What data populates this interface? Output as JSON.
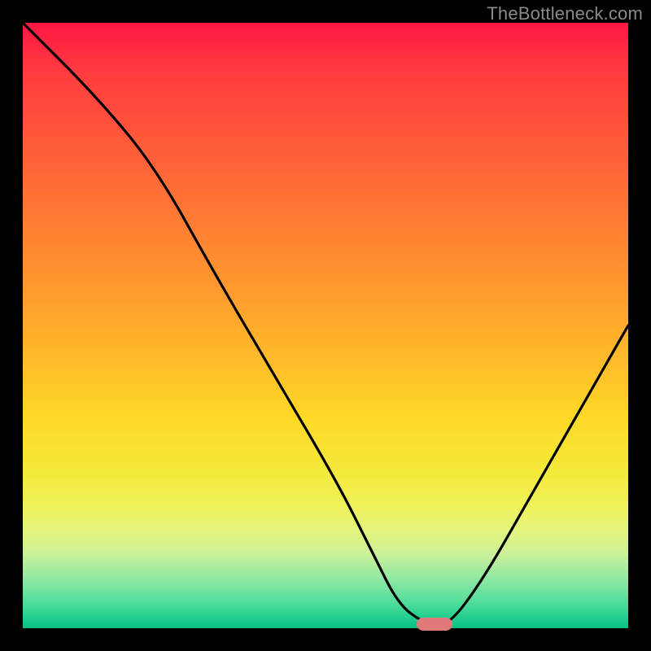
{
  "watermark": "TheBottleneck.com",
  "colors": {
    "frame": "#000000",
    "curve_stroke": "#000000",
    "marker_fill": "#e07a7a",
    "gradient_top": "#ff1744",
    "gradient_mid": "#ffd826",
    "gradient_bottom": "#0fbf80"
  },
  "chart_data": {
    "type": "line",
    "title": "",
    "xlabel": "",
    "ylabel": "",
    "xlim": [
      0,
      100
    ],
    "ylim": [
      0,
      100
    ],
    "grid": false,
    "legend": false,
    "series": [
      {
        "name": "bottleneck-curve",
        "x": [
          0,
          12,
          22,
          32,
          42,
          52,
          58,
          62,
          66,
          70,
          76,
          84,
          92,
          100
        ],
        "values": [
          100,
          88,
          76,
          58,
          41,
          24,
          12,
          4,
          1,
          0,
          8,
          22,
          36,
          50
        ]
      }
    ],
    "annotations": [
      {
        "name": "optimum-marker",
        "shape": "pill",
        "x": 68,
        "y": 0,
        "color": "#e07a7a"
      }
    ]
  }
}
